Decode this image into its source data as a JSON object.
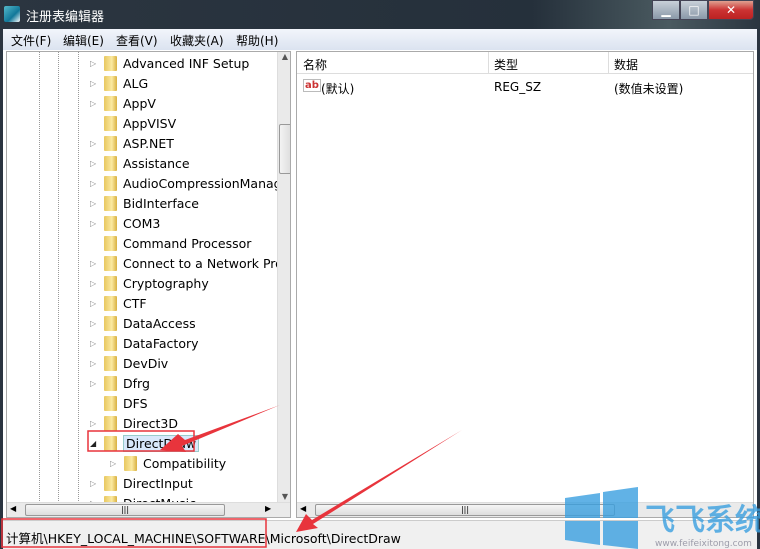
{
  "window": {
    "title": "注册表编辑器",
    "buttons": [
      "minimize",
      "maximize",
      "close"
    ]
  },
  "menu": [
    "文件(F)",
    "编辑(E)",
    "查看(V)",
    "收藏夹(A)",
    "帮助(H)"
  ],
  "tree": {
    "items": [
      {
        "label": "Advanced INF Setup",
        "expandable": true
      },
      {
        "label": "ALG",
        "expandable": true
      },
      {
        "label": "AppV",
        "expandable": true
      },
      {
        "label": "AppVISV",
        "expandable": false
      },
      {
        "label": "ASP.NET",
        "expandable": true
      },
      {
        "label": "Assistance",
        "expandable": true
      },
      {
        "label": "AudioCompressionManager",
        "expandable": true
      },
      {
        "label": "BidInterface",
        "expandable": true
      },
      {
        "label": "COM3",
        "expandable": true
      },
      {
        "label": "Command Processor",
        "expandable": false
      },
      {
        "label": "Connect to a Network Projector",
        "expandable": true
      },
      {
        "label": "Cryptography",
        "expandable": true
      },
      {
        "label": "CTF",
        "expandable": true
      },
      {
        "label": "DataAccess",
        "expandable": true
      },
      {
        "label": "DataFactory",
        "expandable": true
      },
      {
        "label": "DevDiv",
        "expandable": true
      },
      {
        "label": "Dfrg",
        "expandable": true
      },
      {
        "label": "DFS",
        "expandable": false
      },
      {
        "label": "Direct3D",
        "expandable": true
      },
      {
        "label": "DirectDraw",
        "expandable": true,
        "expanded": true,
        "selected": true
      },
      {
        "label": "Compatibility",
        "expandable": true,
        "child": true
      },
      {
        "label": "DirectInput",
        "expandable": true
      },
      {
        "label": "DirectMusic",
        "expandable": true
      }
    ]
  },
  "values": {
    "columns": [
      "名称",
      "类型",
      "数据"
    ],
    "rows": [
      {
        "icon": "ab",
        "name": "(默认)",
        "type": "REG_SZ",
        "data": "(数值未设置)"
      }
    ]
  },
  "status": {
    "path": "计算机\\HKEY_LOCAL_MACHINE\\SOFTWARE\\Microsoft\\DirectDraw"
  },
  "annotation_color": "#e8343c",
  "watermark": {
    "text": "飞飞系统",
    "url": "www.feifeixitong.com"
  }
}
